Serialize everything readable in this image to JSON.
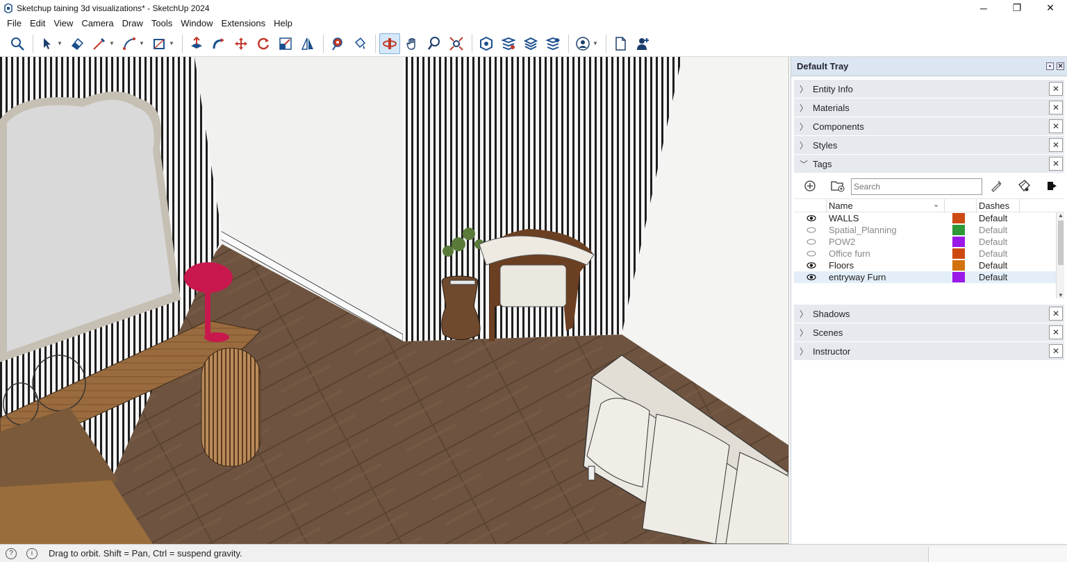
{
  "window": {
    "title": "Sketchup taining 3d visualizations* - SketchUp 2024",
    "minimize": "─",
    "restore": "❐",
    "close": "✕"
  },
  "menu": [
    "File",
    "Edit",
    "View",
    "Camera",
    "Draw",
    "Tools",
    "Window",
    "Extensions",
    "Help"
  ],
  "toolbar": {
    "icons": [
      "search-icon",
      "select-icon",
      "eraser-icon",
      "line-icon",
      "arc-icon",
      "rectangle-icon",
      "push-pull-icon",
      "follow-me-icon",
      "move-icon",
      "rotate-icon",
      "scale-icon",
      "flip-icon",
      "tape-measure-icon",
      "paint-bucket-icon",
      "orbit-icon",
      "pan-icon",
      "zoom-icon",
      "zoom-extents-icon",
      "warehouse-icon",
      "extension-warehouse-icon",
      "layout-icon",
      "extension-manager-icon",
      "account-icon",
      "new-file-icon",
      "add-user-icon"
    ],
    "active": "orbit-icon"
  },
  "tray": {
    "title": "Default Tray",
    "panels_top": [
      {
        "label": "Entity Info",
        "expanded": false
      },
      {
        "label": "Materials",
        "expanded": false
      },
      {
        "label": "Components",
        "expanded": false
      },
      {
        "label": "Styles",
        "expanded": false
      },
      {
        "label": "Tags",
        "expanded": true
      }
    ],
    "panels_bottom": [
      {
        "label": "Shadows",
        "expanded": false
      },
      {
        "label": "Scenes",
        "expanded": false
      },
      {
        "label": "Instructor",
        "expanded": false
      }
    ],
    "close_glyph": "✕"
  },
  "tags": {
    "search_placeholder": "Search",
    "col_name": "Name",
    "col_dashes": "Dashes",
    "rows": [
      {
        "name": "WALLS",
        "visible": true,
        "color": "#cc4a12",
        "dashes": "Default",
        "selected": false
      },
      {
        "name": "Spatial_Planning",
        "visible": false,
        "color": "#2e9a3a",
        "dashes": "Default",
        "selected": false
      },
      {
        "name": "POW2",
        "visible": false,
        "color": "#9a18e8",
        "dashes": "Default",
        "selected": false
      },
      {
        "name": "Office furn",
        "visible": false,
        "color": "#cc4a12",
        "dashes": "Default",
        "selected": false
      },
      {
        "name": "Floors",
        "visible": true,
        "color": "#d1720f",
        "dashes": "Default",
        "selected": false
      },
      {
        "name": "entryway Furn",
        "visible": true,
        "color": "#9a18e8",
        "dashes": "Default",
        "selected": true
      }
    ]
  },
  "status": {
    "text": "Drag to orbit. Shift = Pan, Ctrl = suspend gravity."
  },
  "colors": {
    "tray_header": "#dbe6f2",
    "floor": "#6e5440",
    "wall": "#f3f3f2",
    "lamp": "#c8184e"
  }
}
